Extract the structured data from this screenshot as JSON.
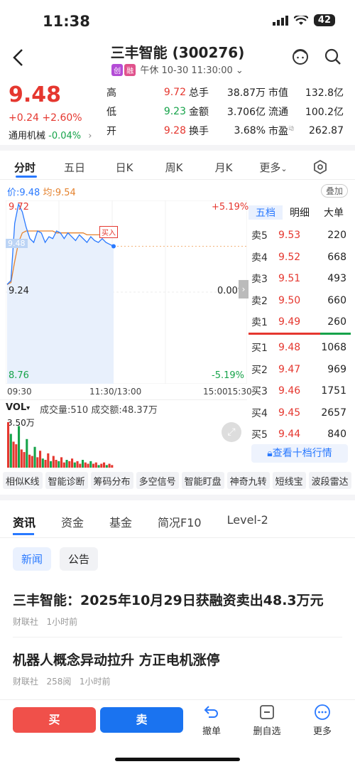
{
  "status": {
    "time": "11:38",
    "battery": "42"
  },
  "header": {
    "title": "三丰智能 (300276)",
    "tag_chuang": "创",
    "tag_rong": "融",
    "session": "午休",
    "datetime": "10-30 11:30:00"
  },
  "quote": {
    "price": "9.48",
    "change": "+0.24 +2.60%",
    "sector_name": "通用机械",
    "sector_change": "-0.04%",
    "rows": [
      {
        "l1": "高",
        "v1": "9.72",
        "l2": "总手",
        "v2": "38.87万",
        "l3": "市值",
        "v3": "132.8亿"
      },
      {
        "l1": "低",
        "v1": "9.23",
        "l2": "金额",
        "v2": "3.706亿",
        "l3": "流通",
        "v3": "100.2亿"
      },
      {
        "l1": "开",
        "v1": "9.28",
        "l2": "换手",
        "v2": "3.68%",
        "l3": "市盈",
        "v3": "262.87"
      }
    ],
    "pe_sup": "动"
  },
  "tabs": [
    "分时",
    "五日",
    "日K",
    "周K",
    "月K",
    "更多"
  ],
  "chart_info": {
    "price_label": "价:9.48",
    "avg_label": "均:9.54",
    "overlay_btn": "叠加",
    "buy_marker": "买入",
    "current_tag": "9.48",
    "y_labels": [
      "9.72",
      "9.24",
      "8.76"
    ],
    "pct_labels": [
      "+5.19%",
      "0.00%",
      "-5.19%"
    ],
    "x_labels": [
      "09:30",
      "11:30/13:00",
      "15:00",
      "15:30"
    ]
  },
  "chart_data": {
    "type": "line",
    "title": "",
    "xlabel": "",
    "ylabel": "",
    "ylim": [
      8.76,
      9.72
    ],
    "x": [
      "09:30",
      "09:31",
      "09:32",
      "09:33",
      "09:35",
      "09:38",
      "09:42",
      "09:46",
      "09:50",
      "09:55",
      "10:00",
      "10:05",
      "10:10",
      "10:15",
      "10:20",
      "10:25",
      "10:30",
      "10:35",
      "10:40",
      "10:45",
      "10:50",
      "10:55",
      "11:00",
      "11:05",
      "11:10",
      "11:15",
      "11:20",
      "11:25",
      "11:30"
    ],
    "series": [
      {
        "values": [
          9.28,
          9.3,
          9.6,
          9.7,
          9.66,
          9.58,
          9.52,
          9.5,
          9.56,
          9.55,
          9.5,
          9.53,
          9.52,
          9.56,
          9.55,
          9.52,
          9.55,
          9.53,
          9.51,
          9.54,
          9.52,
          9.5,
          9.53,
          9.51,
          9.5,
          9.52,
          9.5,
          9.49,
          9.48
        ]
      },
      {
        "values": [
          9.28,
          9.29,
          9.4,
          9.5,
          9.55,
          9.56,
          9.56,
          9.56,
          9.56,
          9.56,
          9.56,
          9.56,
          9.56,
          9.55,
          9.55,
          9.55,
          9.55,
          9.55,
          9.55,
          9.55,
          9.55,
          9.54,
          9.54,
          9.54,
          9.54,
          9.54,
          9.54,
          9.54,
          9.54
        ]
      }
    ]
  },
  "volume": {
    "label": "VOL",
    "summary": "成交量:510 成交额:48.37万",
    "max_label": "3.50万",
    "bars": [
      3.5,
      2.6,
      2.0,
      1.8,
      3.2,
      1.4,
      1.2,
      2.2,
      1.0,
      0.9,
      1.6,
      0.8,
      1.3,
      0.7,
      0.6,
      1.1,
      0.5,
      0.9,
      0.6,
      0.5,
      0.8,
      0.4,
      0.6,
      0.5,
      0.7,
      0.4,
      0.5,
      0.3,
      0.6,
      0.4,
      0.3,
      0.5,
      0.3,
      0.4,
      0.2,
      0.3,
      0.4,
      0.2,
      0.3,
      0.2
    ]
  },
  "orderbook": {
    "tabs": [
      "五档",
      "明细",
      "大单"
    ],
    "asks": [
      {
        "l": "卖5",
        "p": "9.53",
        "v": "220"
      },
      {
        "l": "卖4",
        "p": "9.52",
        "v": "668"
      },
      {
        "l": "卖3",
        "p": "9.51",
        "v": "493"
      },
      {
        "l": "卖2",
        "p": "9.50",
        "v": "660"
      },
      {
        "l": "卖1",
        "p": "9.49",
        "v": "260"
      }
    ],
    "bids": [
      {
        "l": "买1",
        "p": "9.48",
        "v": "1068"
      },
      {
        "l": "买2",
        "p": "9.47",
        "v": "969"
      },
      {
        "l": "买3",
        "p": "9.46",
        "v": "1751"
      },
      {
        "l": "买4",
        "p": "9.45",
        "v": "2657"
      },
      {
        "l": "买5",
        "p": "9.44",
        "v": "840"
      }
    ],
    "ten_levels": "查看十档行情"
  },
  "tools": [
    "相似K线",
    "智能诊断",
    "筹码分布",
    "多空信号",
    "智能盯盘",
    "神奇九转",
    "短线宝",
    "波段雷达"
  ],
  "news_tabs": [
    "资讯",
    "资金",
    "基金",
    "简况F10",
    "Level-2"
  ],
  "news_pills": [
    "新闻",
    "公告"
  ],
  "news": [
    {
      "title": "三丰智能：2025年10月29日获融资卖出48.3万元",
      "source": "财联社",
      "reads": "",
      "time": "1小时前"
    },
    {
      "title": "机器人概念异动拉升 方正电机涨停",
      "source": "财联社",
      "reads": "258阅",
      "time": "1小时前"
    }
  ],
  "bottom": {
    "buy": "买",
    "sell": "卖",
    "cancel": "撤单",
    "remove_watch": "删自选",
    "more": "更多"
  },
  "colors": {
    "up": "#e5372f",
    "down": "#16a34a",
    "accent": "#2979ff"
  }
}
